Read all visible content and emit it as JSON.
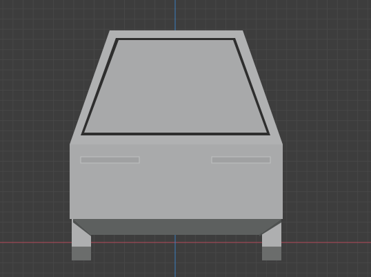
{
  "viewport": {
    "mode": "3d-viewport-front-orthographic",
    "object": "car-model-front-view",
    "show_grid": true,
    "show_axes": [
      "x",
      "z"
    ]
  },
  "colors": {
    "background": "#3d3d3d",
    "grid_minor": "#474747",
    "grid_major": "#505050",
    "x_axis": "#b54a5a",
    "z_axis": "#3c7fbf",
    "body": "#a9aaab",
    "body_edge": "#b4b5b6",
    "windshield": "#a8a9aa",
    "windshield_frame": "#b0b1b2",
    "windshield_gap": "#2e2e2e",
    "light_panel": "#a0a1a2",
    "light_outline": "#c0c1c2",
    "bumper": "#5d605f",
    "bumper_shadow": "#4f5251",
    "wheel_upper": "#aeafb0",
    "wheel_lower": "#6b6d6c"
  }
}
